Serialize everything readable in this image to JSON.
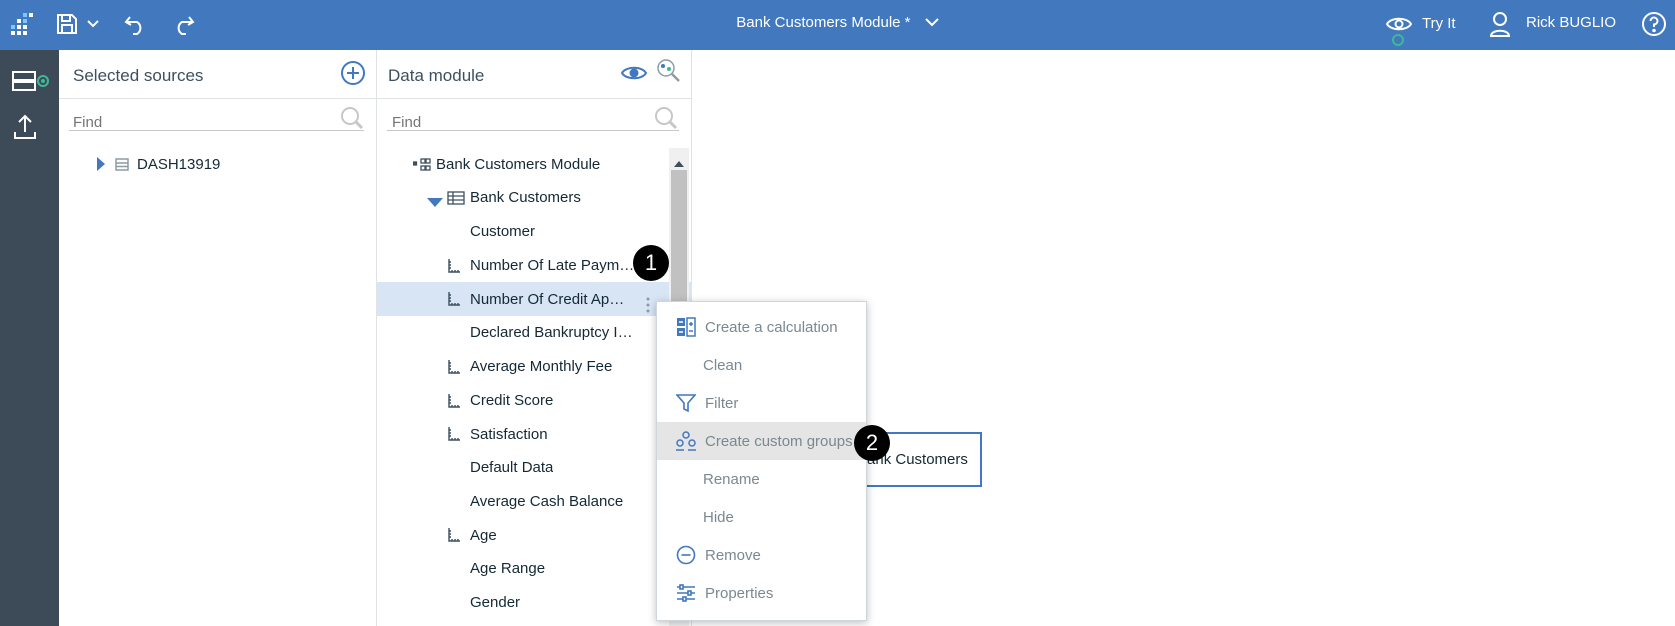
{
  "app": {
    "title": "Bank Customers Module *",
    "try_it": "Try It",
    "user": "Rick BUGLIO"
  },
  "sources_panel": {
    "title": "Selected sources",
    "find_placeholder": "Find",
    "items": [
      {
        "label": "DASH13919"
      }
    ]
  },
  "module_panel": {
    "title": "Data module",
    "find_placeholder": "Find",
    "module_name": "Bank Customers Module",
    "table_name": "Bank Customers",
    "columns": [
      {
        "label": "Customer",
        "icon": "none"
      },
      {
        "label": "Number Of Late Paym…",
        "icon": "measure-icon"
      },
      {
        "label": "Number Of Credit Ap…",
        "icon": "measure-icon",
        "selected": true
      },
      {
        "label": "Declared Bankruptcy I…",
        "icon": "none"
      },
      {
        "label": "Average Monthly Fee",
        "icon": "measure-icon"
      },
      {
        "label": "Credit Score",
        "icon": "measure-icon"
      },
      {
        "label": "Satisfaction",
        "icon": "measure-icon"
      },
      {
        "label": "Default Data",
        "icon": "none"
      },
      {
        "label": "Average Cash Balance",
        "icon": "none"
      },
      {
        "label": "Age",
        "icon": "measure-icon"
      },
      {
        "label": "Age Range",
        "icon": "none"
      },
      {
        "label": "Gender",
        "icon": "none"
      }
    ]
  },
  "context_menu": {
    "items": [
      {
        "label": "Create a calculation",
        "icon": "calculation-icon"
      },
      {
        "label": "Clean",
        "icon": "none"
      },
      {
        "label": "Filter",
        "icon": "filter-icon"
      },
      {
        "label": "Create custom groups",
        "icon": "custom-groups-icon",
        "highlighted": true
      },
      {
        "label": "Rename",
        "icon": "none"
      },
      {
        "label": "Hide",
        "icon": "none"
      },
      {
        "label": "Remove",
        "icon": "remove-icon"
      },
      {
        "label": "Properties",
        "icon": "properties-icon"
      }
    ]
  },
  "canvas": {
    "table_label": "Bank Customers"
  },
  "annotations": {
    "step1": "1",
    "step2": "2"
  },
  "colors": {
    "topbar": "#4178be",
    "leftnav": "#3d4a57",
    "selection": "#d7e5f5",
    "accent": "#4178be",
    "status_green": "#3fb894"
  }
}
